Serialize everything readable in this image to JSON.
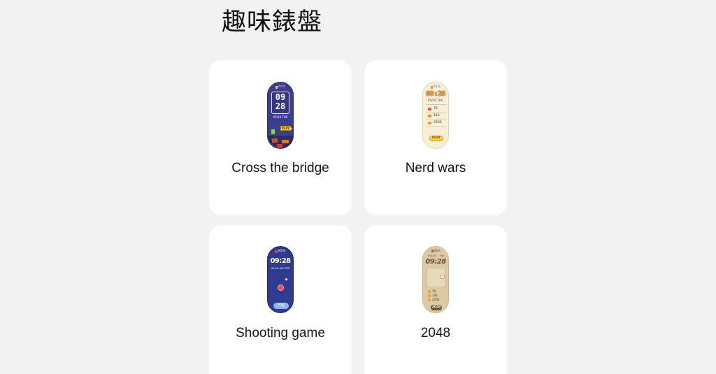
{
  "page": {
    "title": "趣味錶盤"
  },
  "colors": {
    "page_background": "#f2f2f2",
    "card_background": "#ffffff",
    "text": "#151515",
    "navy_face": "#3b3e8e",
    "cream_face": "#f7efd7",
    "beige_face": "#dcc9a6",
    "play_yellow": "#f7d24a"
  },
  "watch_faces": [
    {
      "label": "Cross the bridge",
      "face": {
        "battery": "65%",
        "hour": "09",
        "minute": "28",
        "date": "05/16 TUE",
        "play": "PLAY"
      }
    },
    {
      "label": "Nerd wars",
      "face": {
        "battery": "65%",
        "time": "09:28",
        "date": "05/16 THU",
        "stats": [
          "78",
          "142",
          "2560"
        ],
        "play": "PLAY"
      }
    },
    {
      "label": "Shooting game",
      "face": {
        "battery": "85%",
        "time": "09:28",
        "date": "05/16 AM TUE",
        "start": "开始"
      }
    },
    {
      "label": "2048",
      "face": {
        "battery": "85%",
        "date": "05/16",
        "weekday": "Tue",
        "time": "09:28",
        "stats": [
          "78",
          "142",
          "2560"
        ],
        "badge": "2048"
      }
    }
  ]
}
